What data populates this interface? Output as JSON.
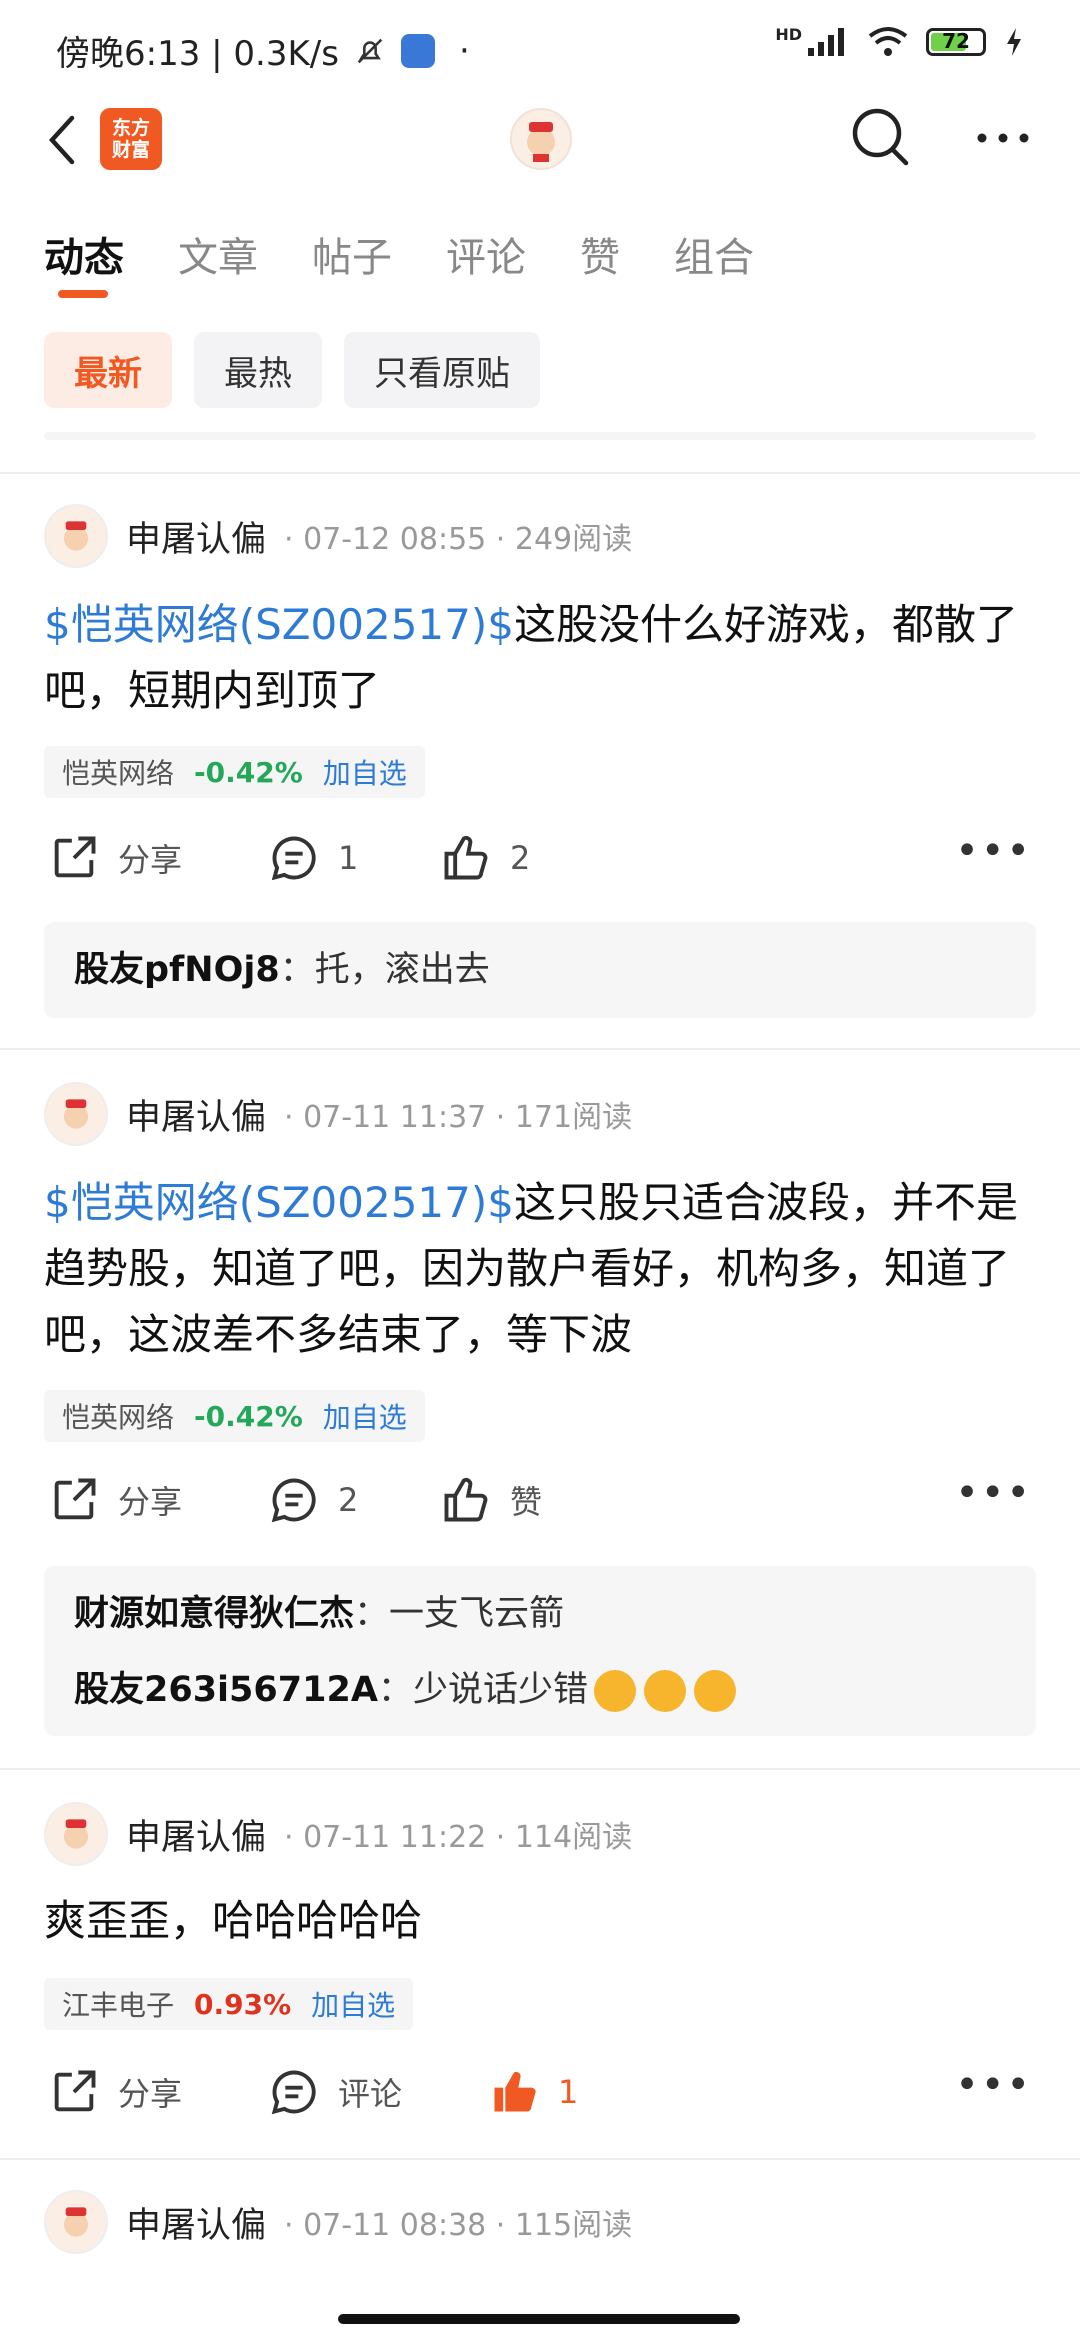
{
  "status_bar": {
    "time_text": "傍晚6:13 | 0.3K/s",
    "dot": "·",
    "hd": "HD",
    "battery": "72",
    "icons": [
      "mute-bell-icon",
      "app-notification-icon",
      "signal-icon",
      "wifi-icon",
      "battery-icon",
      "charging-icon"
    ]
  },
  "header": {
    "logo_line1": "东方",
    "logo_line2": "财富",
    "icons": [
      "back-icon",
      "avatar",
      "search-icon",
      "more-icon"
    ]
  },
  "tabs": [
    "动态",
    "文章",
    "帖子",
    "评论",
    "赞",
    "组合"
  ],
  "filters": [
    "最新",
    "最热",
    "只看原贴"
  ],
  "posts": [
    {
      "author": "申屠认偏",
      "meta": "· 07-12 08:55 · 249阅读",
      "link": "$恺英网络(SZ002517)$",
      "text": "这股没什么好游戏，都散了吧，短期内到顶了",
      "stock": {
        "name": "恺英网络",
        "pct": "-0.42%",
        "add": "加自选"
      },
      "share": "分享",
      "comment": "1",
      "like": "2",
      "replies": [
        {
          "user": "股友pfNOj8",
          "text": "托，滚出去"
        }
      ]
    },
    {
      "author": "申屠认偏",
      "meta": "· 07-11 11:37 · 171阅读",
      "link": "$恺英网络(SZ002517)$",
      "text": "这只股只适合波段，并不是趋势股，知道了吧，因为散户看好，机构多，知道了吧，这波差不多结束了，等下波",
      "stock": {
        "name": "恺英网络",
        "pct": "-0.42%",
        "add": "加自选"
      },
      "share": "分享",
      "comment": "2",
      "like": "赞",
      "replies": [
        {
          "user": "财源如意得狄仁杰",
          "text": "一支飞云箭"
        },
        {
          "user": "股友263i56712A",
          "text": "少说话少错"
        }
      ]
    },
    {
      "author": "申屠认偏",
      "meta": "· 07-11 11:22 · 114阅读",
      "text": "爽歪歪，哈哈哈哈哈",
      "stock": {
        "name": "江丰电子",
        "pct": "0.93%",
        "add": "加自选"
      },
      "share": "分享",
      "comment": "评论",
      "like": "1"
    },
    {
      "author": "申屠认偏",
      "meta": "· 07-11 08:38 · 115阅读"
    }
  ],
  "colors": {
    "accent": "#f05a22",
    "link": "#2e7bd6",
    "up": "#e0331f",
    "down": "#23a85a"
  }
}
